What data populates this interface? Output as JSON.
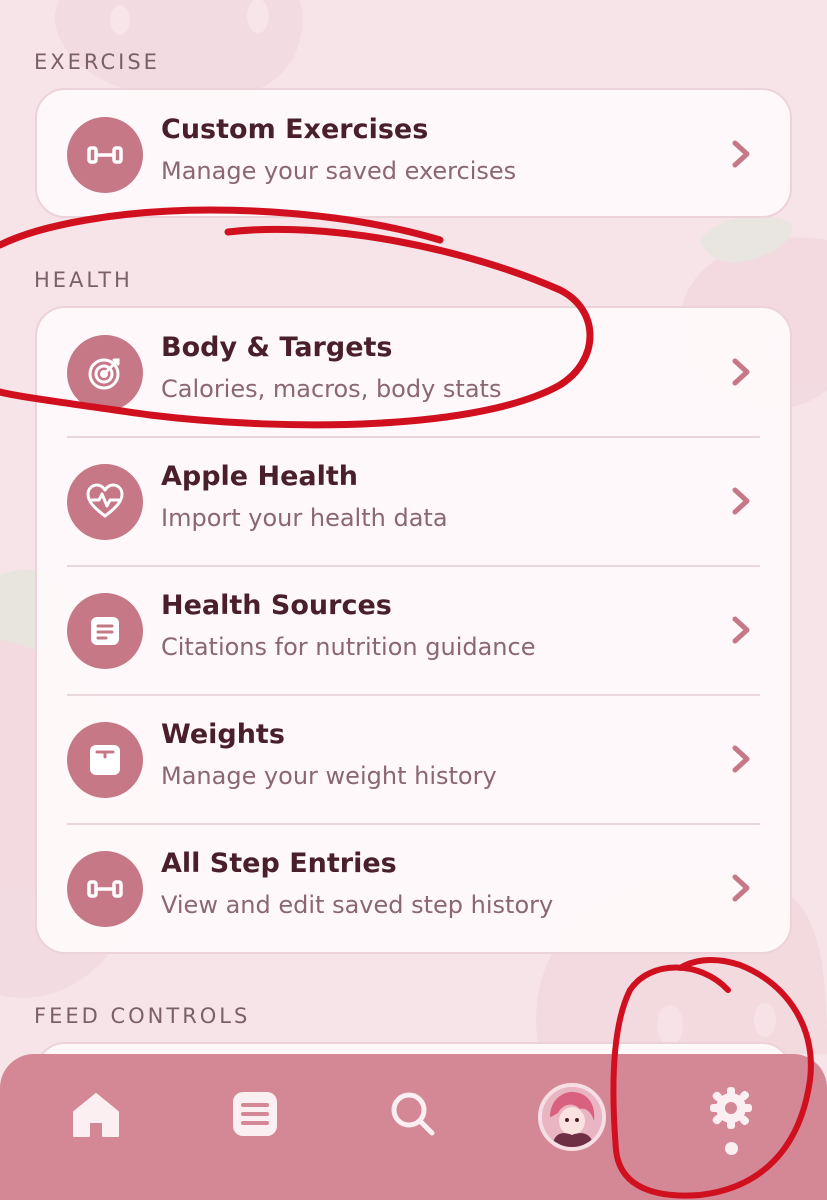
{
  "sections": {
    "exercise": {
      "label": "EXERCISE",
      "items": [
        {
          "title": "Custom Exercises",
          "subtitle": "Manage your saved exercises",
          "icon": "dumbbell-icon"
        }
      ]
    },
    "health": {
      "label": "HEALTH",
      "items": [
        {
          "title": "Body & Targets",
          "subtitle": "Calories, macros, body stats",
          "icon": "target-icon"
        },
        {
          "title": "Apple Health",
          "subtitle": "Import your health data",
          "icon": "heart-pulse-icon"
        },
        {
          "title": "Health Sources",
          "subtitle": "Citations for nutrition guidance",
          "icon": "document-icon"
        },
        {
          "title": "Weights",
          "subtitle": "Manage your weight history",
          "icon": "scale-icon"
        },
        {
          "title": "All Step Entries",
          "subtitle": "View and edit saved step history",
          "icon": "dumbbell-icon"
        }
      ]
    },
    "feed_controls": {
      "label": "FEED CONTROLS"
    }
  },
  "tabbar": {
    "tabs": [
      {
        "icon": "home-icon"
      },
      {
        "icon": "list-icon"
      },
      {
        "icon": "search-icon"
      },
      {
        "icon": "avatar"
      },
      {
        "icon": "gear-icon",
        "active": true
      }
    ]
  },
  "colors": {
    "background": "#f7e4e8",
    "card": "#fffafb",
    "accent": "#c67886",
    "tabbar": "#d48794",
    "title_text": "#4a1f2c",
    "subtitle_text": "#8a6772",
    "annotation": "#d0101e"
  }
}
